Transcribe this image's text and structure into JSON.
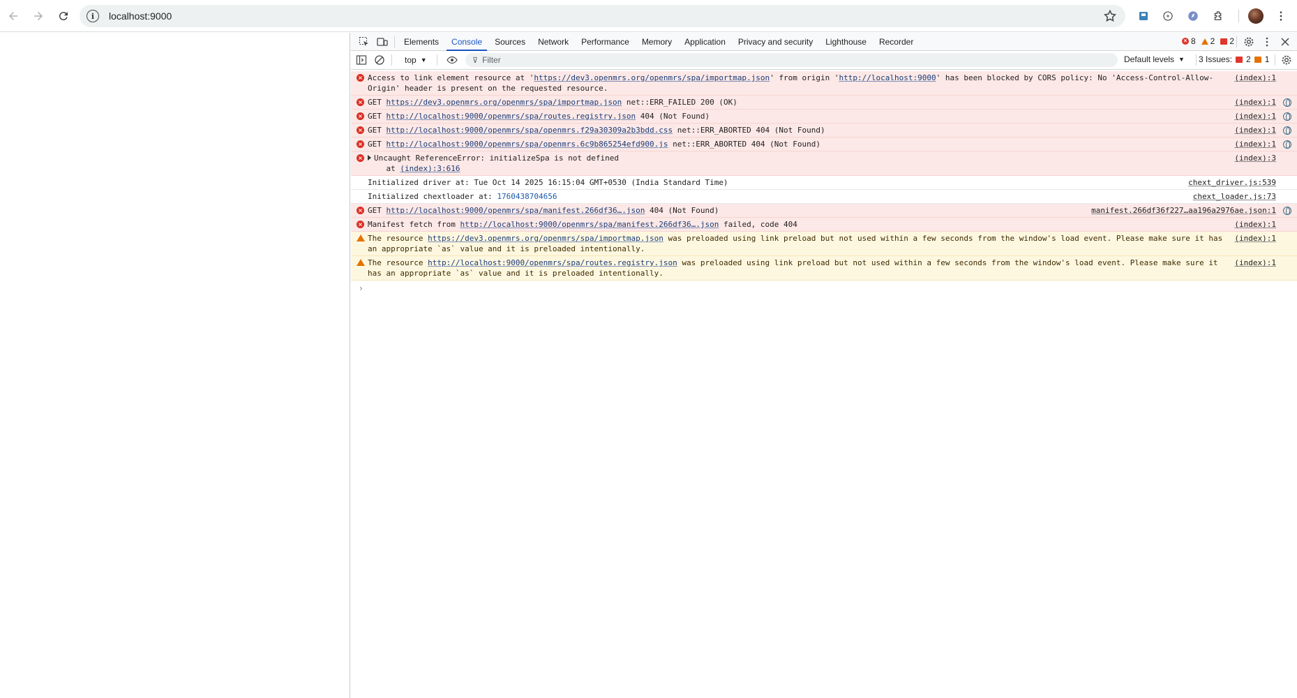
{
  "browser": {
    "url": "localhost:9000"
  },
  "devtools": {
    "tabs": [
      "Elements",
      "Console",
      "Sources",
      "Network",
      "Performance",
      "Memory",
      "Application",
      "Privacy and security",
      "Lighthouse",
      "Recorder"
    ],
    "active_tab": "Console",
    "counts": {
      "errors": "8",
      "warnings": "2",
      "issues": "2"
    },
    "toolbar": {
      "context": "top",
      "filter_placeholder": "Filter",
      "levels": "Default levels",
      "issues_label": "3 Issues:",
      "issues_errors": "2",
      "issues_warnings": "1"
    },
    "messages": [
      {
        "type": "error",
        "parts": [
          [
            "t",
            "Access to link element resource at '"
          ],
          [
            "l",
            "https://dev3.openmrs.org/openmrs/spa/importmap.json"
          ],
          [
            "t",
            "' from origin '"
          ],
          [
            "l",
            "http://localhost:9000"
          ],
          [
            "t",
            "' has been blocked by CORS policy: No 'Access-Control-Allow-\nOrigin' header is present on the requested resource."
          ]
        ],
        "src": "(index):1",
        "globe": false
      },
      {
        "type": "error",
        "parts": [
          [
            "t",
            "GET "
          ],
          [
            "l",
            "https://dev3.openmrs.org/openmrs/spa/importmap.json"
          ],
          [
            "t",
            " net::ERR_FAILED 200 (OK)"
          ]
        ],
        "src": "(index):1",
        "globe": true
      },
      {
        "type": "error",
        "parts": [
          [
            "t",
            "GET "
          ],
          [
            "l",
            "http://localhost:9000/openmrs/spa/routes.registry.json"
          ],
          [
            "t",
            " 404 (Not Found)"
          ]
        ],
        "src": "(index):1",
        "globe": true
      },
      {
        "type": "error",
        "parts": [
          [
            "t",
            "GET "
          ],
          [
            "l",
            "http://localhost:9000/openmrs/spa/openmrs.f29a30309a2b3bdd.css"
          ],
          [
            "t",
            " net::ERR_ABORTED 404 (Not Found)"
          ]
        ],
        "src": "(index):1",
        "globe": true
      },
      {
        "type": "error",
        "parts": [
          [
            "t",
            "GET "
          ],
          [
            "l",
            "http://localhost:9000/openmrs/spa/openmrs.6c9b865254efd900.js"
          ],
          [
            "t",
            " net::ERR_ABORTED 404 (Not Found)"
          ]
        ],
        "src": "(index):1",
        "globe": true
      },
      {
        "type": "error",
        "expand": true,
        "parts": [
          [
            "t",
            "Uncaught ReferenceError: initializeSpa is not defined\n    at "
          ],
          [
            "l",
            "(index):3:616"
          ]
        ],
        "src": "(index):3",
        "globe": false
      },
      {
        "type": "info",
        "parts": [
          [
            "t",
            "Initialized driver at: Tue Oct 14 2025 16:15:04 GMT+0530 (India Standard Time)"
          ]
        ],
        "src": "chext_driver.js:539",
        "globe": false
      },
      {
        "type": "info",
        "parts": [
          [
            "t",
            "Initialized chextloader at: "
          ],
          [
            "n",
            "1760438704656"
          ]
        ],
        "src": "chext_loader.js:73",
        "globe": false
      },
      {
        "type": "error",
        "parts": [
          [
            "t",
            "GET "
          ],
          [
            "l",
            "http://localhost:9000/openmrs/spa/manifest.266df36….json"
          ],
          [
            "t",
            " 404 (Not Found)"
          ]
        ],
        "src": "manifest.266df36f227…aa196a2976ae.json:1",
        "globe": true
      },
      {
        "type": "error",
        "parts": [
          [
            "t",
            "Manifest fetch from "
          ],
          [
            "l",
            "http://localhost:9000/openmrs/spa/manifest.266df36….json"
          ],
          [
            "t",
            " failed, code 404"
          ]
        ],
        "src": "(index):1",
        "globe": false
      },
      {
        "type": "warn",
        "parts": [
          [
            "t",
            "The resource "
          ],
          [
            "l",
            "https://dev3.openmrs.org/openmrs/spa/importmap.json"
          ],
          [
            "t",
            " was preloaded using link preload but not used within a few seconds from the window's load event. Please make sure it has\nan appropriate `as` value and it is preloaded intentionally."
          ]
        ],
        "src": "(index):1",
        "globe": false
      },
      {
        "type": "warn",
        "parts": [
          [
            "t",
            "The resource "
          ],
          [
            "l",
            "http://localhost:9000/openmrs/spa/routes.registry.json"
          ],
          [
            "t",
            " was preloaded using link preload but not used within a few seconds from the window's load event. Please make sure it\nhas an appropriate `as` value and it is preloaded intentionally."
          ]
        ],
        "src": "(index):1",
        "globe": false
      }
    ],
    "prompt": "›"
  }
}
